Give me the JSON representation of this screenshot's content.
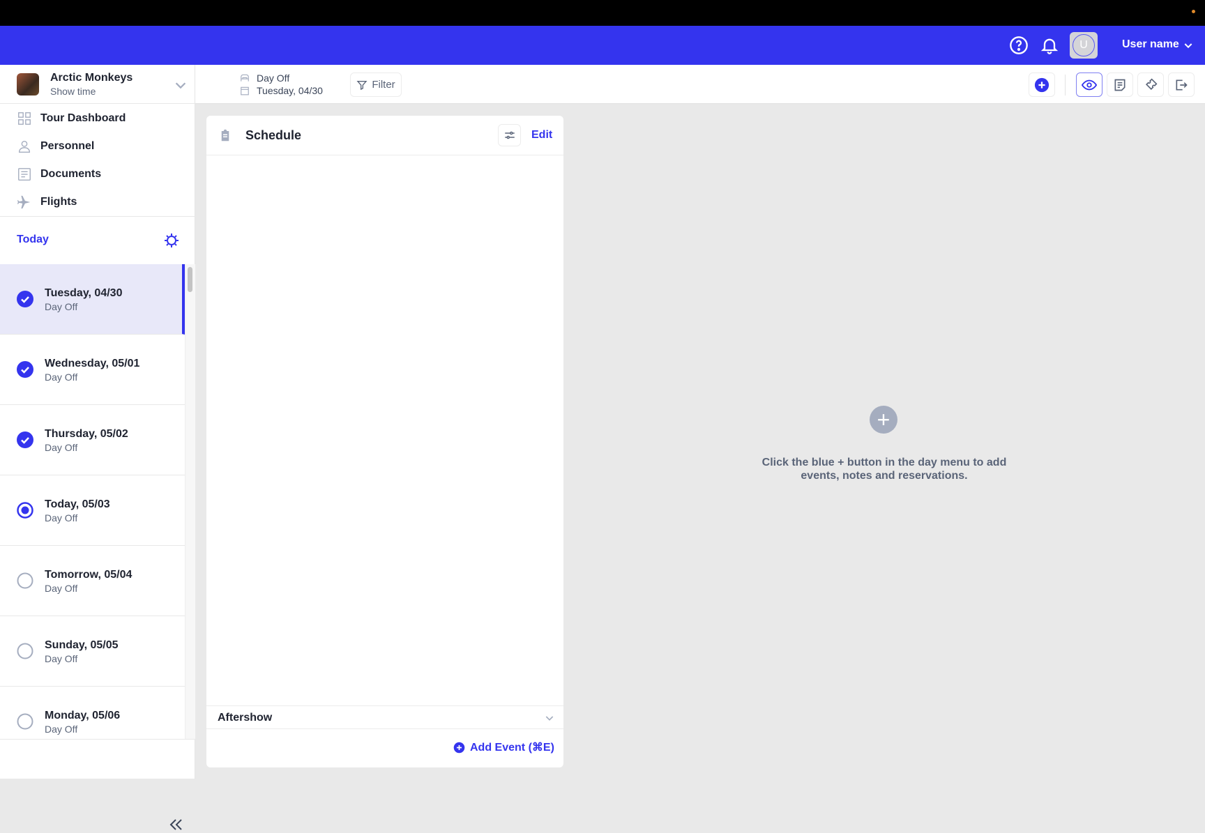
{
  "header": {
    "user_initial": "U",
    "user_name": "User name"
  },
  "band": {
    "name": "Arctic Monkeys",
    "subtitle": "Show time"
  },
  "nav": [
    {
      "label": "Tour Dashboard",
      "icon": "grid-icon"
    },
    {
      "label": "Personnel",
      "icon": "person-icon"
    },
    {
      "label": "Documents",
      "icon": "document-icon"
    },
    {
      "label": "Flights",
      "icon": "plane-icon"
    }
  ],
  "today_label": "Today",
  "days": [
    {
      "title": "Tuesday, 04/30",
      "sub": "Day Off",
      "state": "done",
      "selected": true
    },
    {
      "title": "Wednesday, 05/01",
      "sub": "Day Off",
      "state": "done"
    },
    {
      "title": "Thursday, 05/02",
      "sub": "Day Off",
      "state": "done"
    },
    {
      "title": "Today, 05/03",
      "sub": "Day Off",
      "state": "current"
    },
    {
      "title": "Tomorrow, 05/04",
      "sub": "Day Off",
      "state": "todo"
    },
    {
      "title": "Sunday, 05/05",
      "sub": "Day Off",
      "state": "todo"
    },
    {
      "title": "Monday, 05/06",
      "sub": "Day Off",
      "state": "todo"
    }
  ],
  "toolbar": {
    "day_type": "Day Off",
    "date": "Tuesday, 04/30",
    "filter": "Filter"
  },
  "schedule": {
    "title": "Schedule",
    "edit": "Edit",
    "section": "Aftershow",
    "add_event": "Add Event (⌘E)"
  },
  "empty": {
    "message": "Click the blue + button in the day menu to add events, notes and reservations."
  },
  "colors": {
    "accent": "#3434ee"
  }
}
